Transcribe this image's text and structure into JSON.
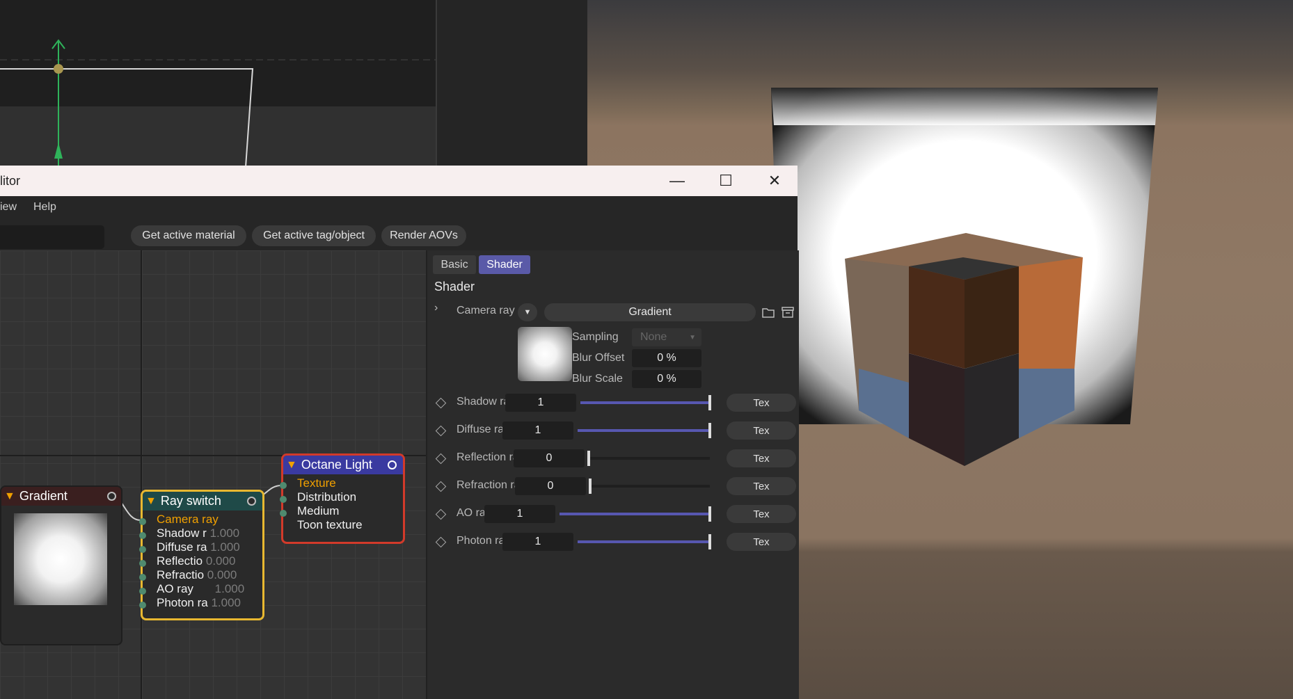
{
  "window": {
    "title": "litor",
    "controls": {
      "minimize": "—",
      "maximize": "☐",
      "close": "✕"
    }
  },
  "menu": {
    "items": [
      "iew",
      "Help"
    ]
  },
  "toolbar": {
    "buttons": [
      "Get active material",
      "Get active tag/object",
      "Render AOVs"
    ]
  },
  "tabs": {
    "basic": "Basic",
    "shader": "Shader"
  },
  "section_title": "Shader",
  "camera_ray": {
    "label": "Camera ray",
    "texture_name": "Gradient",
    "sampling_label": "Sampling",
    "sampling_value": "None",
    "blur_offset_label": "Blur Offset",
    "blur_offset_value": "0 %",
    "blur_scale_label": "Blur Scale",
    "blur_scale_value": "0 %"
  },
  "rays": [
    {
      "label": "Shadow ray",
      "value": "1",
      "fraction": 1.0,
      "tex": "Tex"
    },
    {
      "label": "Diffuse ray",
      "value": "1",
      "fraction": 1.0,
      "tex": "Tex"
    },
    {
      "label": "Reflection ray",
      "value": "0",
      "fraction": 0.0,
      "tex": "Tex"
    },
    {
      "label": "Refraction ray",
      "value": "0",
      "fraction": 0.0,
      "tex": "Tex"
    },
    {
      "label": "AO ray",
      "value": "1",
      "fraction": 1.0,
      "tex": "Tex"
    },
    {
      "label": "Photon ray",
      "value": "1",
      "fraction": 1.0,
      "tex": "Tex"
    }
  ],
  "nodes": {
    "gradient": {
      "title": "Gradient"
    },
    "ray_switch": {
      "title": "Ray switch",
      "rows": [
        {
          "label": "Camera ray",
          "value": ""
        },
        {
          "label": "Shadow r",
          "value": "1.000"
        },
        {
          "label": "Diffuse ra",
          "value": "1.000"
        },
        {
          "label": "Reflectio",
          "value": "0.000"
        },
        {
          "label": "Refractio",
          "value": "0.000"
        },
        {
          "label": "AO ray",
          "value": "1.000"
        },
        {
          "label": "Photon ra",
          "value": "1.000"
        }
      ]
    },
    "octane_light": {
      "title": "Octane Light",
      "rows": [
        "Texture",
        "Distribution",
        "Medium",
        "Toon texture"
      ]
    }
  },
  "colors": {
    "accent": "#5a5aa8",
    "node_orange": "#f0a000",
    "node_yellow_border": "#e8b830",
    "node_red_border": "#d23a2a",
    "light_header": "#3a3aa0",
    "ray_header": "#1f4a48",
    "gradient_header": "#3a1f1f"
  }
}
